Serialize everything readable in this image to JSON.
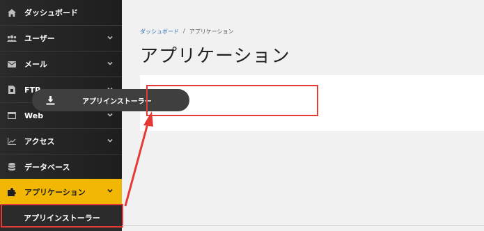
{
  "sidebar": {
    "items": [
      {
        "label": "ダッシュボード",
        "icon": "home-icon",
        "chevron": false
      },
      {
        "label": "ユーザー",
        "icon": "users-icon",
        "chevron": true
      },
      {
        "label": "メール",
        "icon": "mail-icon",
        "chevron": true
      },
      {
        "label": "FTP",
        "icon": "file-icon",
        "chevron": true
      },
      {
        "label": "Web",
        "icon": "window-icon",
        "chevron": true
      },
      {
        "label": "アクセス",
        "icon": "chart-icon",
        "chevron": true
      },
      {
        "label": "データベース",
        "icon": "database-icon",
        "chevron": false
      },
      {
        "label": "アプリケーション",
        "icon": "puzzle-icon",
        "chevron": true,
        "active": true
      }
    ],
    "sub_item": "アプリインストーラー",
    "active_color": "#f2b704"
  },
  "breadcrumb": {
    "home": "ダッシュボード",
    "separator": "/",
    "current": "アプリケーション"
  },
  "page": {
    "title": "アプリケーション",
    "installer_button": "アプリインストーラー"
  },
  "annotation": {
    "highlight_color": "#e53935"
  }
}
